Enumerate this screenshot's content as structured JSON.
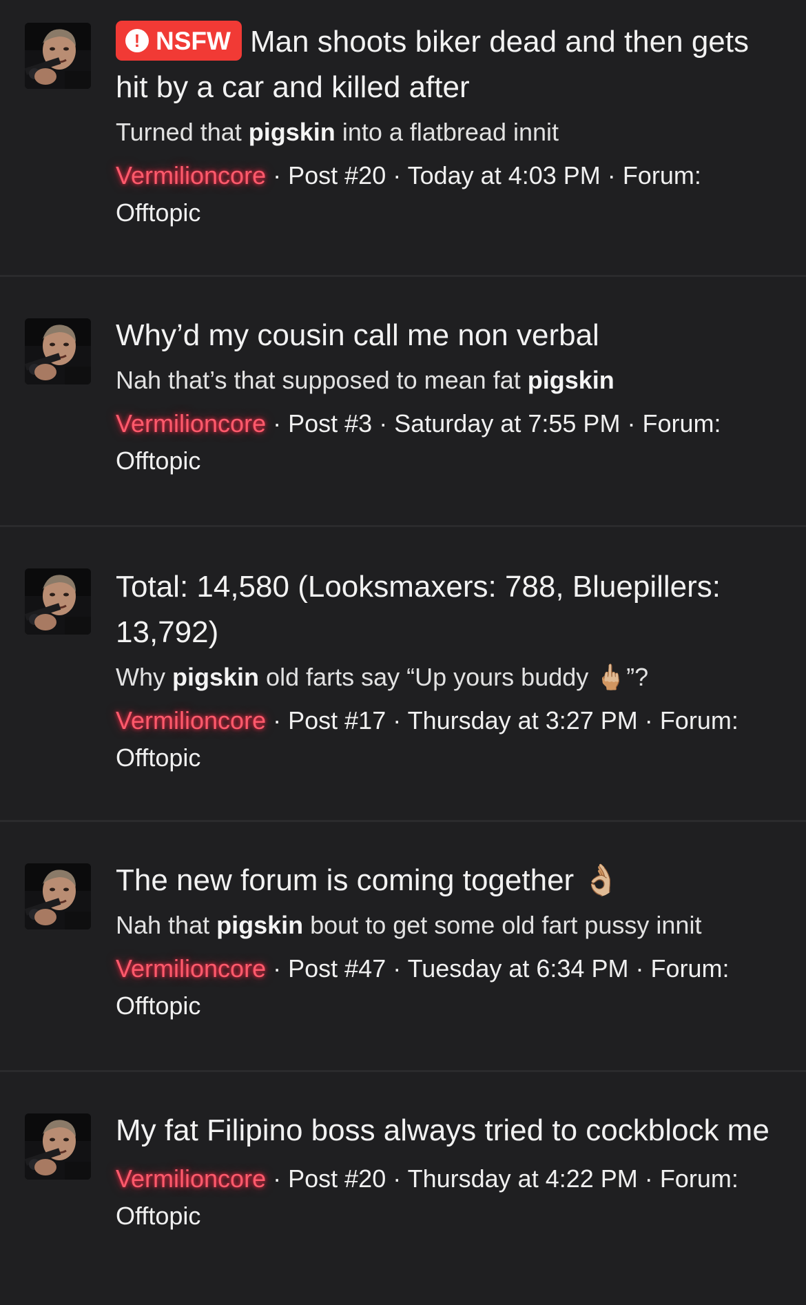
{
  "results": [
    {
      "badge": "NSFW",
      "badge_icon": "exclamation-circle-icon",
      "title": "Man shoots biker dead and then gets hit by a car and killed after",
      "snippet_before": "Turned that ",
      "snippet_bold": "pigskin",
      "snippet_after": " into a flatbread innit",
      "username": "Vermilioncore",
      "post": "Post #20",
      "date": "Today at 4:03 PM",
      "forum_label": "Forum:",
      "forum": "Offtopic"
    },
    {
      "title": "Why’d my cousin call me non verbal",
      "snippet_before": "Nah that’s that supposed to mean fat ",
      "snippet_bold": "pigskin",
      "snippet_after": "",
      "username": "Vermilioncore",
      "post": "Post #3",
      "date": "Saturday at 7:55 PM",
      "forum_label": "Forum:",
      "forum": "Offtopic"
    },
    {
      "title": "Total: 14,580 (Looksmaxers: 788, Bluepillers: 13,792)",
      "snippet_before": "Why ",
      "snippet_bold": "pigskin",
      "snippet_after": " old farts say “Up yours buddy 🖕🏼”?",
      "username": "Vermilioncore",
      "post": "Post #17",
      "date": "Thursday at 3:27 PM",
      "forum_label": "Forum:",
      "forum": "Offtopic"
    },
    {
      "title": "The new forum is coming together 👌🏼",
      "snippet_before": "Nah that ",
      "snippet_bold": "pigskin",
      "snippet_after": " bout to get some old fart pussy innit",
      "username": "Vermilioncore",
      "post": "Post #47",
      "date": "Tuesday at 6:34 PM",
      "forum_label": "Forum:",
      "forum": "Offtopic"
    },
    {
      "title": "My fat Filipino boss always tried to cockblock me",
      "username": "Vermilioncore",
      "post": "Post #20",
      "date": "Thursday at 4:22 PM",
      "forum_label": "Forum:",
      "forum": "Offtopic"
    }
  ],
  "separator": "·",
  "colors": {
    "background": "#1f1f21",
    "divider": "#2b2b2d",
    "username": "#ff5a6c",
    "nsfw_badge": "#f13a35"
  }
}
